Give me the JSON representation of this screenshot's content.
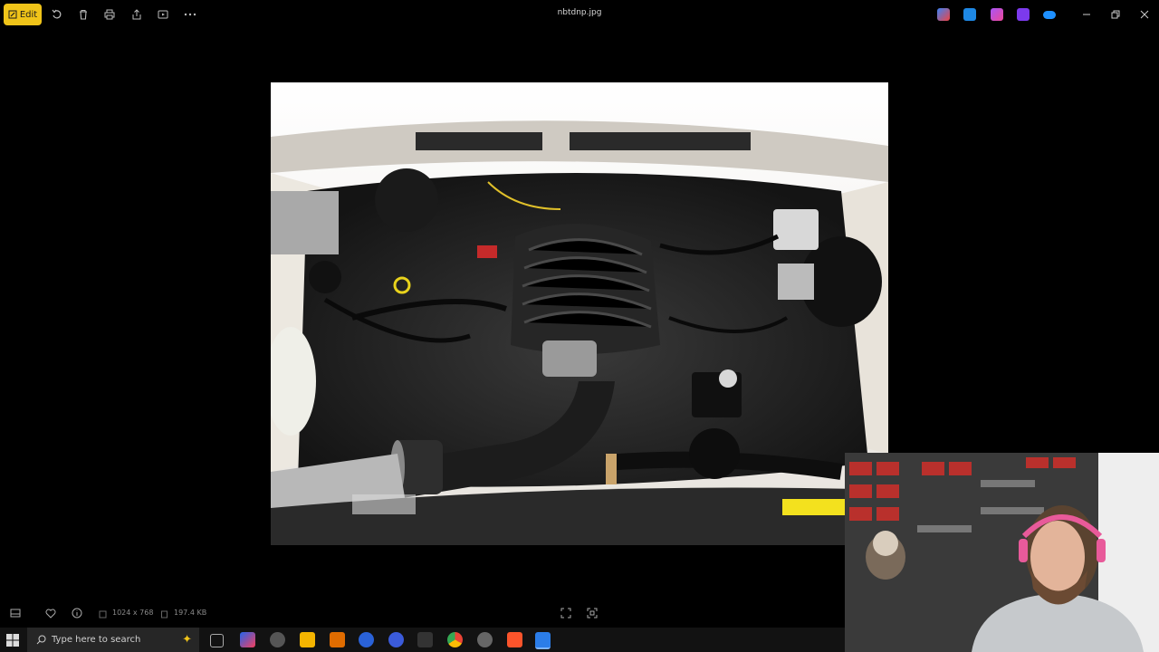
{
  "toolbar": {
    "edit_label": "Edit",
    "icons": [
      "rotate-icon",
      "delete-icon",
      "print-icon",
      "share-icon",
      "slideshow-icon",
      "more-icon"
    ]
  },
  "window": {
    "title": "nbtdnp.jpg",
    "controls": [
      "minimize",
      "restore",
      "close"
    ]
  },
  "image": {
    "alt": "Engine bay with V8 engine, intake tube and wiring harness"
  },
  "status": {
    "dimensions": "1024 x 768",
    "file_size": "197.4 KB"
  },
  "taskbar": {
    "search_placeholder": "Type here to search"
  },
  "colors": {
    "accent": "#f0c419",
    "background": "#000000",
    "taskbar": "#121212"
  }
}
